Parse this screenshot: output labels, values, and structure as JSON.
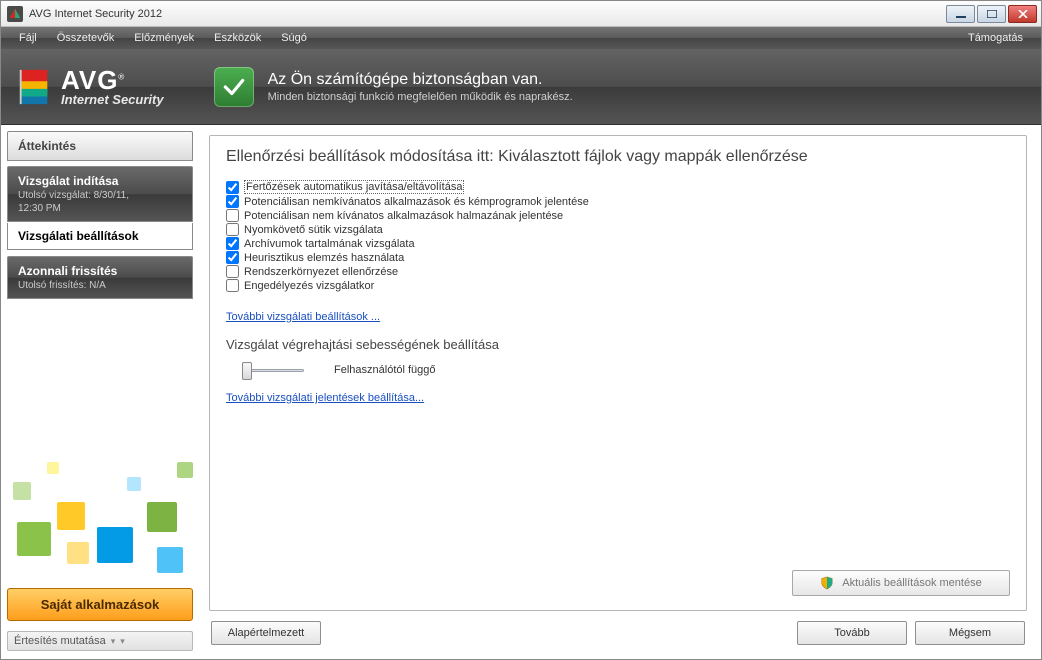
{
  "window": {
    "title": "AVG Internet Security 2012"
  },
  "menu": {
    "items": [
      "Fájl",
      "Összetevők",
      "Előzmények",
      "Eszközök",
      "Súgó"
    ],
    "support": "Támogatás"
  },
  "logo": {
    "name": "AVG",
    "sub": "Internet Security"
  },
  "status": {
    "headline": "Az Ön számítógépe biztonságban van.",
    "sub": "Minden biztonsági funkció megfelelően működik és naprakész."
  },
  "sidebar": {
    "overview": "Áttekintés",
    "scan": {
      "title": "Vizsgálat indítása",
      "sub1": "Utolsó vizsgálat: 8/30/11,",
      "sub2": "12:30 PM"
    },
    "scan_settings": "Vizsgálati beállítások",
    "update": {
      "title": "Azonnali frissítés",
      "sub": "Utolsó frissítés: N/A"
    },
    "apps": "Saját alkalmazások",
    "notif": "Értesítés mutatása"
  },
  "panel": {
    "title": "Ellenőrzési beállítások módosítása itt: Kiválasztott fájlok vagy mappák ellenőrzése",
    "checks": [
      {
        "label": "Fertőzések automatikus javítása/eltávolítása",
        "checked": true,
        "focus": true
      },
      {
        "label": "Potenciálisan nemkívánatos alkalmazások és kémprogramok jelentése",
        "checked": true
      },
      {
        "label": "Potenciálisan nem kívánatos alkalmazások halmazának jelentése",
        "checked": false
      },
      {
        "label": "Nyomkövető sütik vizsgálata",
        "checked": false
      },
      {
        "label": "Archívumok tartalmának vizsgálata",
        "checked": true
      },
      {
        "label": "Heurisztikus elemzés használata",
        "checked": true
      },
      {
        "label": "Rendszerkörnyezet ellenőrzése",
        "checked": false
      },
      {
        "label": "Engedélyezés vizsgálatkor",
        "checked": false
      }
    ],
    "link1": "További vizsgálati beállítások ...",
    "speed_header": "Vizsgálat végrehajtási sebességének beállítása",
    "speed_value": "Felhasználótól függő",
    "link2": "További vizsgálati jelentések beállítása...",
    "save": "Aktuális beállítások mentése"
  },
  "buttons": {
    "default": "Alapértelmezett",
    "next": "Tovább",
    "cancel": "Mégsem"
  }
}
